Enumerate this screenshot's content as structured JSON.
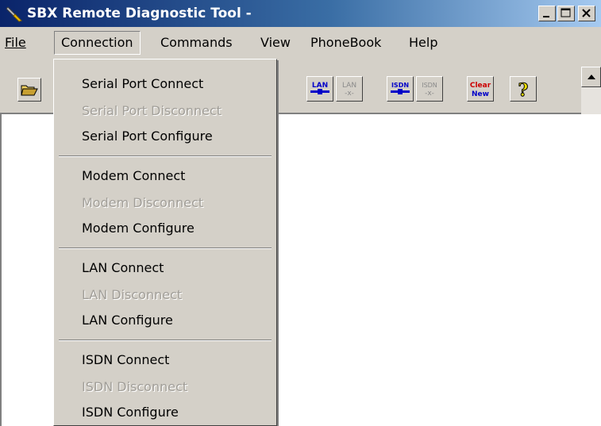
{
  "window": {
    "title": "SBX Remote Diagnostic Tool  -",
    "controls": [
      "minimize",
      "maximize",
      "close"
    ]
  },
  "menubar": {
    "items": [
      "File",
      "Connection",
      "Commands",
      "View",
      "PhoneBook",
      "Help"
    ],
    "active": "Connection"
  },
  "toolbar": {
    "buttons": [
      {
        "name": "open-folder-icon"
      },
      {
        "name": "lan-connect-icon",
        "label": "LAN"
      },
      {
        "name": "lan-disconnect-icon",
        "label": "LAN",
        "sub": "-x-"
      },
      {
        "name": "isdn-connect-icon",
        "label": "ISDN"
      },
      {
        "name": "isdn-disconnect-icon",
        "label": "ISDN",
        "sub": "-x-"
      },
      {
        "name": "clear-new-icon",
        "label1": "Clear",
        "label2": "New"
      },
      {
        "name": "help-icon",
        "label": "?"
      }
    ]
  },
  "connection_menu": {
    "items": [
      {
        "label": "Serial Port Connect",
        "enabled": true
      },
      {
        "label": "Serial Port Disconnect",
        "enabled": false
      },
      {
        "label": "Serial Port Configure",
        "enabled": true
      },
      {
        "label": "Modem Connect",
        "enabled": true
      },
      {
        "label": "Modem Disconnect",
        "enabled": false
      },
      {
        "label": "Modem Configure",
        "enabled": true
      },
      {
        "label": "LAN Connect",
        "enabled": true
      },
      {
        "label": "LAN Disconnect",
        "enabled": false
      },
      {
        "label": "LAN Configure",
        "enabled": true
      },
      {
        "label": "ISDN Connect",
        "enabled": true
      },
      {
        "label": "ISDN Disconnect",
        "enabled": false
      },
      {
        "label": "ISDN Configure",
        "enabled": true
      }
    ]
  },
  "colors": {
    "titlebar_start": "#0a246a",
    "titlebar_end": "#a6caf0",
    "face": "#d4d0c8",
    "disabled_text": "#a19e98",
    "icon_blue": "#0000c8",
    "icon_red": "#cc0000"
  }
}
